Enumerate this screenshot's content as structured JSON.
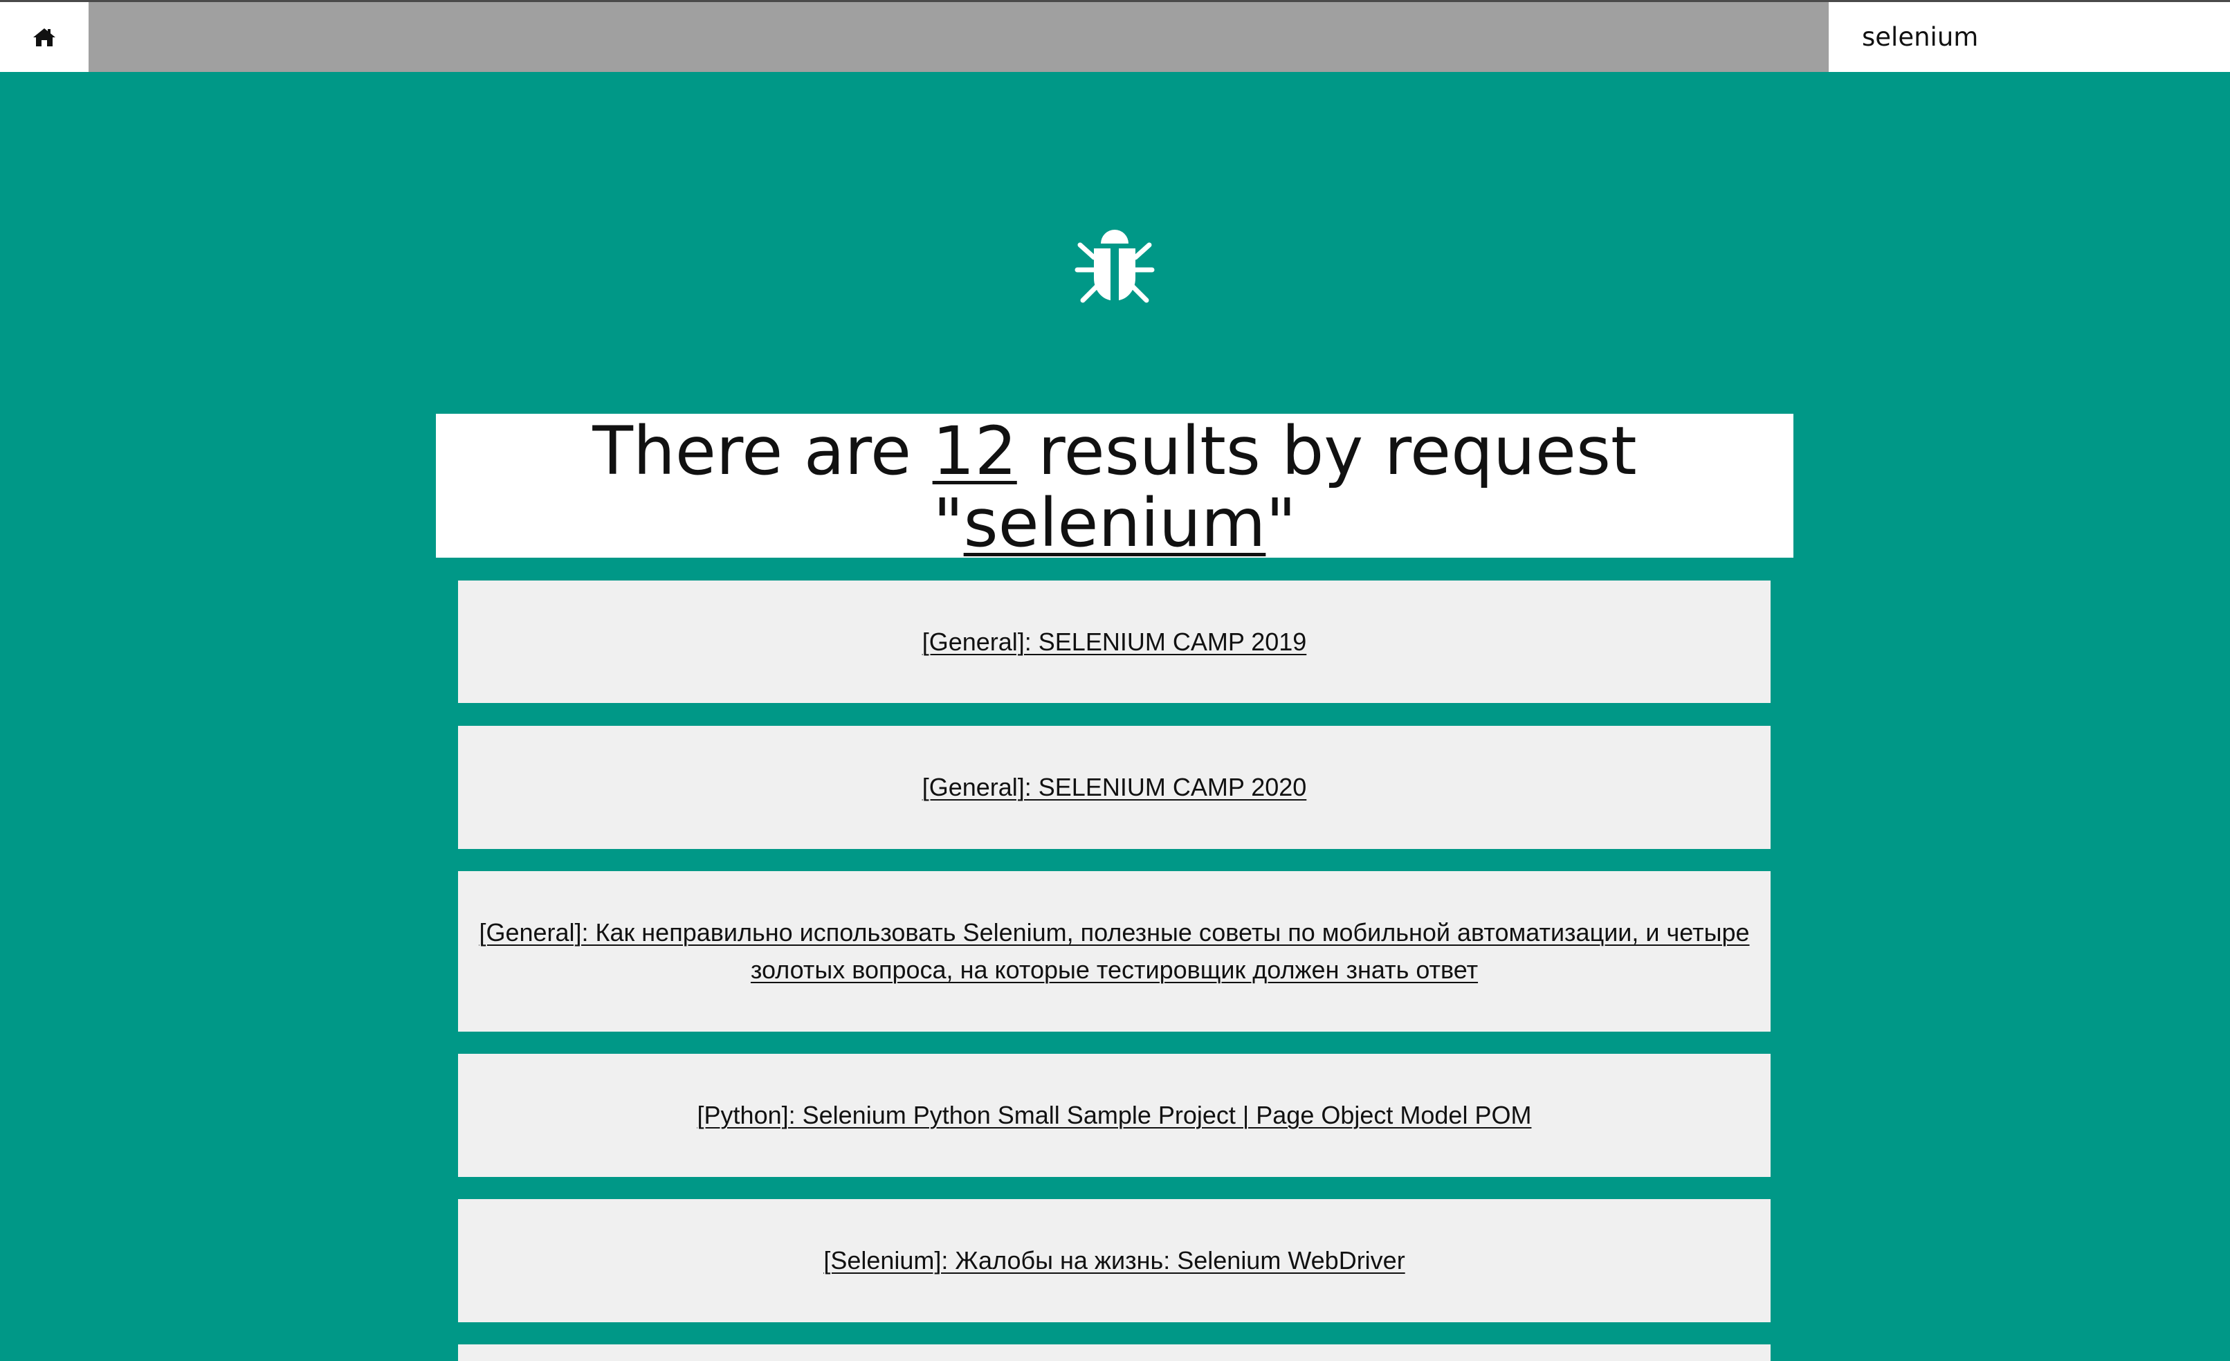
{
  "header": {
    "home_icon": "home-icon",
    "search": {
      "value": "selenium",
      "placeholder": ""
    }
  },
  "hero": {
    "icon": "bug-icon"
  },
  "summary": {
    "prefix": "There are ",
    "count": "12",
    "middle": " results by request ",
    "quote_open": "\"",
    "query": "selenium",
    "quote_close": "\""
  },
  "results": [
    {
      "label": "[General]: SELENIUM CAMP 2019"
    },
    {
      "label": "[General]: SELENIUM CAMP 2020"
    },
    {
      "label": "[General]: Как неправильно использовать Selenium, полезные советы по мобильной автоматизации, и четыре золотых вопроса, на которые тестировщик должен знать ответ"
    },
    {
      "label": "[Python]: Selenium Python Small Sample Project | Page Object Model POM"
    },
    {
      "label": "[Selenium]: Жалобы на жизнь: Selenium WebDriver"
    },
    {
      "label": ""
    }
  ],
  "colors": {
    "background": "#009887",
    "topbar": "#a0a0a0",
    "card": "#f0f0f0"
  }
}
